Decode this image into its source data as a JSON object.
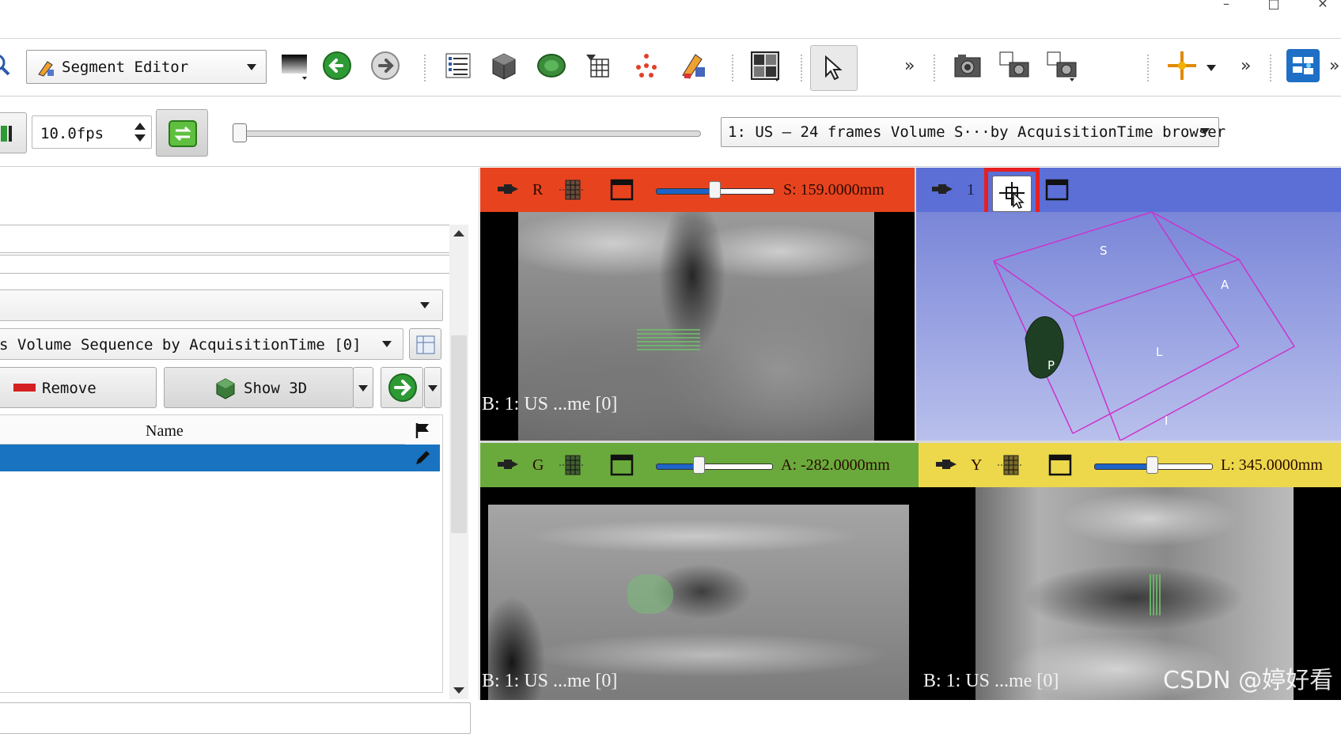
{
  "window": {
    "minimize": "–",
    "maximize": "□",
    "close": "✕"
  },
  "toolbar": {
    "module_selector": "Segment Editor",
    "overflow_1": "»",
    "overflow_2": "»",
    "overflow_3": "»"
  },
  "sequence": {
    "fps": "10.0fps",
    "browser": "1: US – 24 frames Volume S···by AcquisitionTime browser"
  },
  "left_panel": {
    "source_volume": "s Volume Sequence by AcquisitionTime [0]",
    "remove_label": "Remove",
    "show3d_label": "Show 3D",
    "table_header_name": "Name"
  },
  "views": {
    "red": {
      "letter": "R",
      "offset": "S: 159.0000mm",
      "corner": "B: 1: US ...me [0]",
      "slider_fraction": 0.52
    },
    "threed": {
      "letter": "1",
      "axis_labels": [
        "S",
        "A",
        "L",
        "P",
        "I"
      ]
    },
    "green": {
      "letter": "G",
      "offset": "A: -282.0000mm",
      "corner": "B: 1: US ...me [0]",
      "slider_fraction": 0.38
    },
    "yellow": {
      "letter": "Y",
      "offset": "L: 345.0000mm",
      "corner": "B: 1: US ...me [0]",
      "slider_fraction": 0.49
    }
  },
  "watermark": "CSDN @婷好看",
  "colors": {
    "red_view": "#e8431f",
    "threed_view": "#5b6fd6",
    "green_view": "#6aaa3c",
    "yellow_view": "#ecd84a",
    "selected_row": "#1a73c1",
    "highlight_box": "#e62020",
    "box_edges": "#cc33cc"
  }
}
